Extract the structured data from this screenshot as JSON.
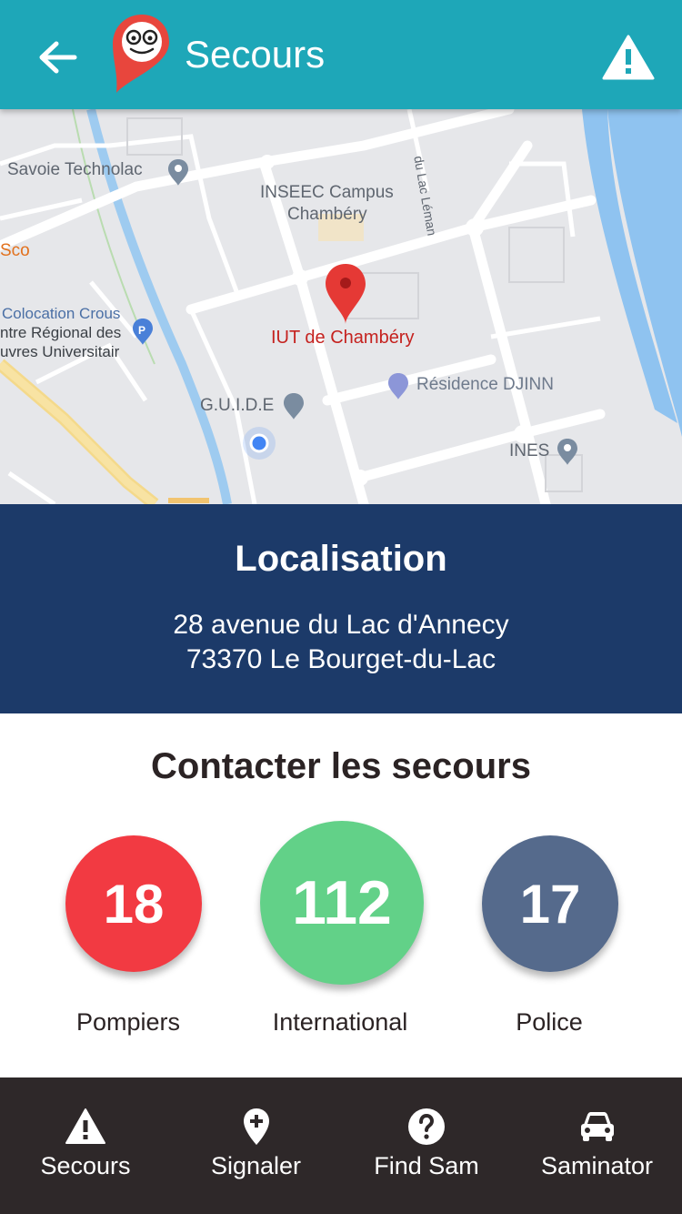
{
  "header": {
    "title": "Secours",
    "back_icon": "arrow-left-icon",
    "alert_icon": "warning-icon",
    "color": "#1ea7b8"
  },
  "map": {
    "labels": {
      "savoie_technolac": "Savoie Technolac",
      "inseec_1": "INSEEC Campus",
      "inseec_2": "Chambéry",
      "sco": "Sco",
      "crous_1": "Colocation Crous",
      "crous_2": "ntre Régional des",
      "crous_3": "uvres Universitair",
      "iut": "IUT de Chambéry",
      "djinn": "Résidence DJINN",
      "guide": "G.U.I.D.E",
      "ines": "INES",
      "lac_leman": "du Lac Léman"
    }
  },
  "localisation": {
    "title": "Localisation",
    "address_line1": "28 avenue du Lac d'Annecy",
    "address_line2": "73370 Le Bourget-du-Lac",
    "color": "#1c3a69"
  },
  "contacts": {
    "title": "Contacter les secours",
    "items": [
      {
        "number": "18",
        "label": "Pompiers",
        "color": "#f23a42"
      },
      {
        "number": "112",
        "label": "International",
        "color": "#62d188"
      },
      {
        "number": "17",
        "label": "Police",
        "color": "#556a8c"
      }
    ]
  },
  "nav": {
    "items": [
      {
        "label": "Secours",
        "icon": "warning-icon"
      },
      {
        "label": "Signaler",
        "icon": "add-location-icon"
      },
      {
        "label": "Find Sam",
        "icon": "help-circle-icon"
      },
      {
        "label": "Saminator",
        "icon": "car-icon"
      }
    ]
  }
}
